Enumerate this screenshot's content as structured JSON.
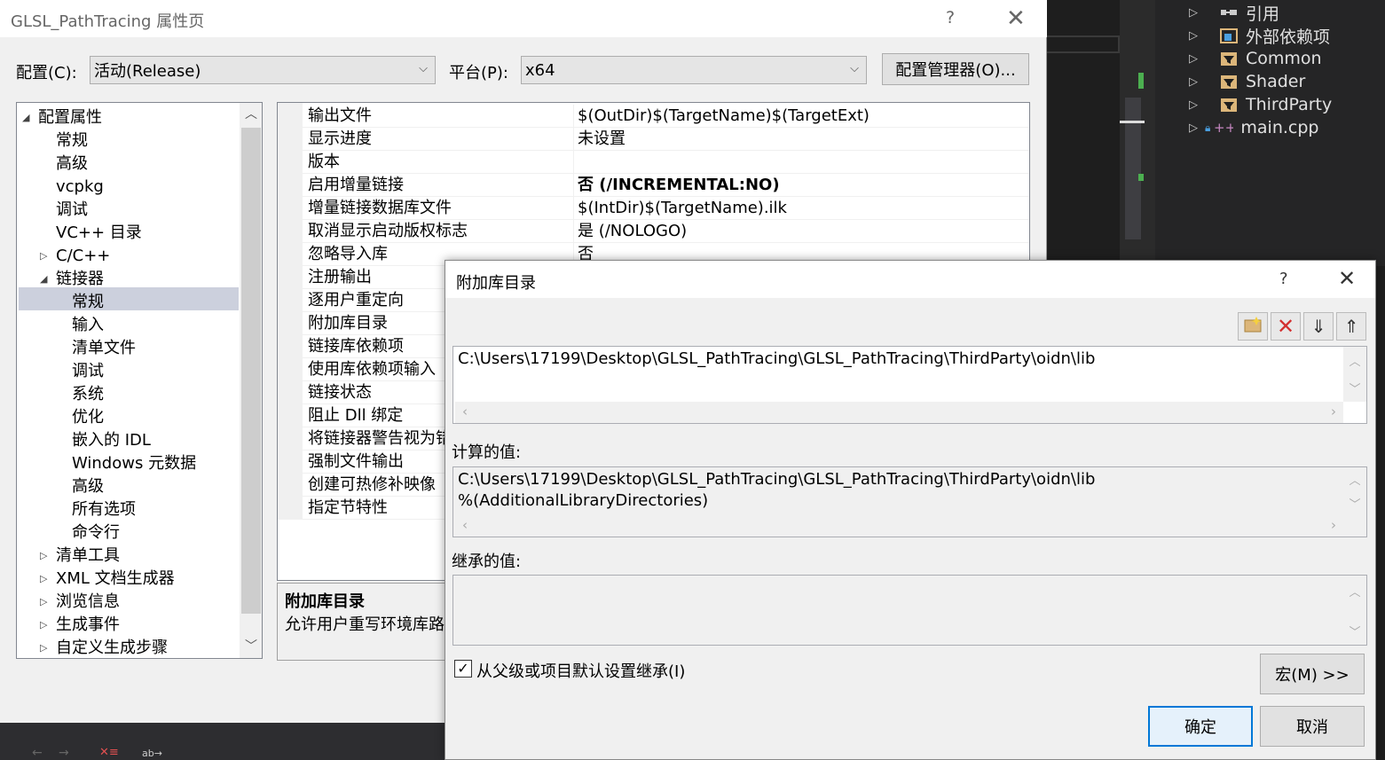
{
  "window_title": "GLSL_PathTracing 属性页",
  "help_glyph": "?",
  "close_glyph": "✕",
  "config_label": "配置(C):",
  "config_value": "活动(Release)",
  "platform_label": "平台(P):",
  "platform_value": "x64",
  "config_manager_label": "配置管理器(O)...",
  "tree": {
    "items": [
      {
        "label": "配置属性",
        "expander": "◢"
      },
      {
        "label": "常规"
      },
      {
        "label": "高级"
      },
      {
        "label": "vcpkg"
      },
      {
        "label": "调试"
      },
      {
        "label": "VC++ 目录"
      },
      {
        "label": "C/C++",
        "expander": "▷"
      },
      {
        "label": "链接器",
        "expander": "◢"
      },
      {
        "label": "常规",
        "selected": true
      },
      {
        "label": "输入"
      },
      {
        "label": "清单文件"
      },
      {
        "label": "调试"
      },
      {
        "label": "系统"
      },
      {
        "label": "优化"
      },
      {
        "label": "嵌入的 IDL"
      },
      {
        "label": "Windows 元数据"
      },
      {
        "label": "高级"
      },
      {
        "label": "所有选项"
      },
      {
        "label": "命令行"
      },
      {
        "label": "清单工具",
        "expander": "▷"
      },
      {
        "label": "XML 文档生成器",
        "expander": "▷"
      },
      {
        "label": "浏览信息",
        "expander": "▷"
      },
      {
        "label": "生成事件",
        "expander": "▷"
      },
      {
        "label": "自定义生成步骤",
        "expander": "▷"
      }
    ]
  },
  "grid": {
    "rows": [
      {
        "name": "输出文件",
        "value": "$(OutDir)$(TargetName)$(TargetExt)"
      },
      {
        "name": "显示进度",
        "value": "未设置"
      },
      {
        "name": "版本",
        "value": ""
      },
      {
        "name": "启用增量链接",
        "value": "否 (/INCREMENTAL:NO)"
      },
      {
        "name": "增量链接数据库文件",
        "value": "$(IntDir)$(TargetName).ilk"
      },
      {
        "name": "取消显示启动版权标志",
        "value": "是 (/NOLOGO)"
      },
      {
        "name": "忽略导入库",
        "value": "否"
      },
      {
        "name": "注册输出",
        "value": ""
      },
      {
        "name": "逐用户重定向",
        "value": ""
      },
      {
        "name": "附加库目录",
        "value": ""
      },
      {
        "name": "链接库依赖项",
        "value": ""
      },
      {
        "name": "使用库依赖项输入",
        "value": ""
      },
      {
        "name": "链接状态",
        "value": ""
      },
      {
        "name": "阻止 Dll 绑定",
        "value": ""
      },
      {
        "name": "将链接器警告视为错",
        "value": ""
      },
      {
        "name": "强制文件输出",
        "value": ""
      },
      {
        "name": "创建可热修补映像",
        "value": ""
      },
      {
        "name": "指定节特性",
        "value": ""
      }
    ]
  },
  "description": {
    "title": "附加库目录",
    "text": "允许用户重写环境库路"
  },
  "solution_explorer": {
    "items": [
      {
        "label": "引用",
        "icon": "references-icon"
      },
      {
        "label": "外部依赖项",
        "icon": "external-deps-icon"
      },
      {
        "label": "Common",
        "icon": "filter-folder-icon"
      },
      {
        "label": "Shader",
        "icon": "filter-folder-icon"
      },
      {
        "label": "ThirdParty",
        "icon": "filter-folder-icon"
      },
      {
        "label": "main.cpp",
        "icon": "cpp-file-icon"
      }
    ]
  },
  "dialog": {
    "title": "附加库目录",
    "help_glyph": "?",
    "close_glyph": "✕",
    "toolbar": [
      "new-line-icon",
      "delete-icon",
      "move-down-icon",
      "move-up-icon"
    ],
    "edit_value": "C:\\Users\\17199\\Desktop\\GLSL_PathTracing\\GLSL_PathTracing\\ThirdParty\\oidn\\lib",
    "evaluated_label": "计算的值:",
    "evaluated_line1": "C:\\Users\\17199\\Desktop\\GLSL_PathTracing\\GLSL_PathTracing\\ThirdParty\\oidn\\lib",
    "evaluated_line2": "%(AdditionalLibraryDirectories)",
    "inherited_label": "继承的值:",
    "inherit_checkbox_label": "从父级或项目默认设置继承(I)",
    "inherit_checked": true,
    "macros_label": "宏(M) >>",
    "ok_label": "确定",
    "cancel_label": "取消"
  },
  "colors": {
    "accent": "#0078d7",
    "selection": "#ccd0dd",
    "vs_dark": "#1e1e1e"
  }
}
